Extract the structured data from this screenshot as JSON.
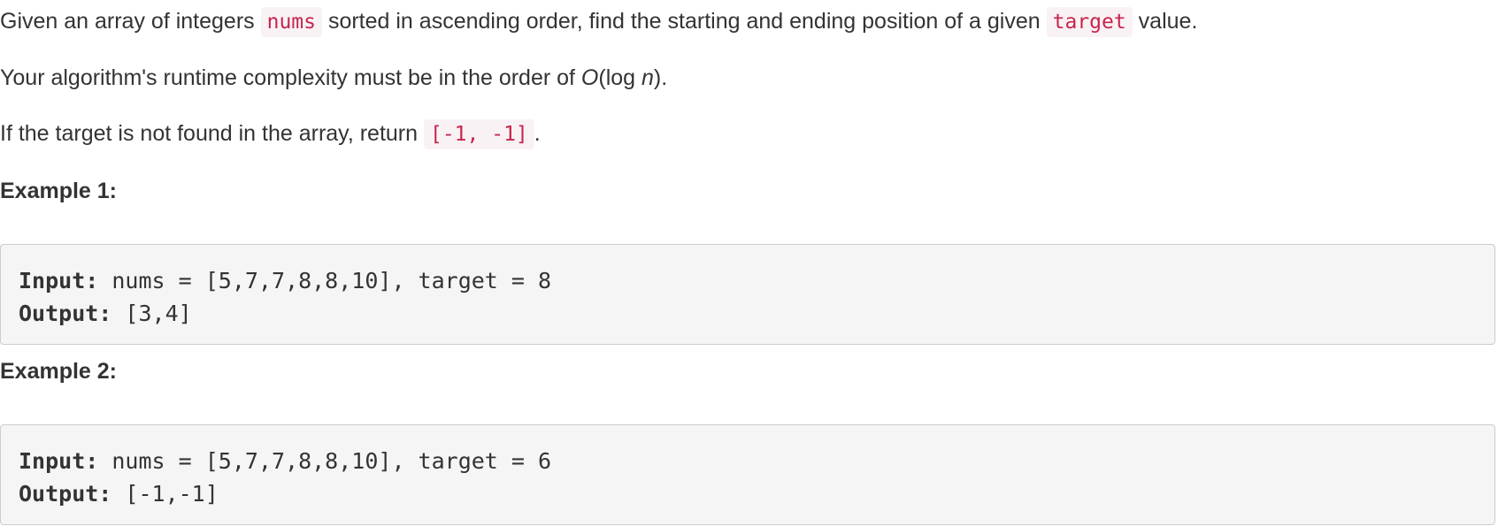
{
  "description": {
    "p1_before": "Given an array of integers",
    "p1_code1": "nums",
    "p1_middle": "sorted in ascending order, find the starting and ending position of a given",
    "p1_code2": "target",
    "p1_after": "value.",
    "p2_before": "Your algorithm's runtime complexity must be in the order of ",
    "p2_big_o": "O",
    "p2_log": "(log ",
    "p2_n": "n",
    "p2_after": ").",
    "p3_before": "If the target is not found in the array, return",
    "p3_code": "[-1, -1]",
    "p3_after": "."
  },
  "examples": [
    {
      "heading": "Example 1:",
      "input_label": "Input:",
      "input_value": " nums = [5,7,7,8,8,10], target = 8",
      "output_label": "Output:",
      "output_value": " [3,4]"
    },
    {
      "heading": "Example 2:",
      "input_label": "Input:",
      "input_value": " nums = [5,7,7,8,8,10], target = 6",
      "output_label": "Output:",
      "output_value": " [-1,-1]"
    }
  ]
}
